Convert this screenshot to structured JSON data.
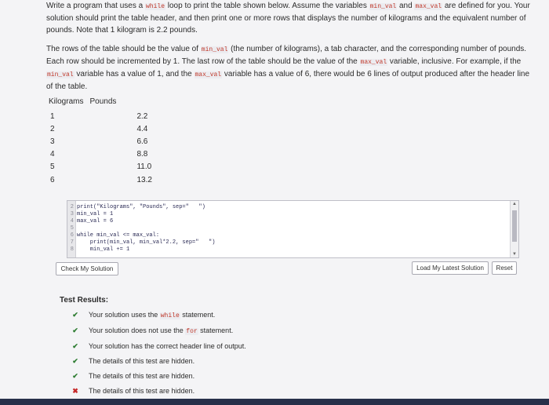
{
  "instructions": {
    "p1_a": "Write a program that uses a ",
    "p1_kw1": "while",
    "p1_b": " loop to print the table shown below. Assume the variables ",
    "p1_kw2": "min_val",
    "p1_c": " and ",
    "p1_kw3": "max_val",
    "p1_d": " are defined for you. Your solution should print the table header, and then print one or more rows that displays the number of kilograms and the equivalent number of pounds. Note that 1 kilogram is 2.2 pounds.",
    "p2_a": "The rows of the table should be the value of ",
    "p2_kw1": "min_val",
    "p2_b": " (the number of kilograms), a tab character, and the corresponding number of pounds. Each row should be incremented by 1. The last row of the table should be the value of the ",
    "p2_kw2": "max_val",
    "p2_c": " variable, inclusive. For example, if the ",
    "p2_kw3": "min_val",
    "p2_d": " variable has a value of 1, and the ",
    "p2_kw4": "max_val",
    "p2_e": " variable has a value of 6, there would be 6 lines of output produced after the header line of the table."
  },
  "sample_table": {
    "headers": [
      "Kilograms",
      "Pounds"
    ],
    "rows": [
      [
        "1",
        "2.2"
      ],
      [
        "2",
        "4.4"
      ],
      [
        "3",
        "6.6"
      ],
      [
        "4",
        "8.8"
      ],
      [
        "5",
        "11.0"
      ],
      [
        "6",
        "13.2"
      ]
    ]
  },
  "code_editor": {
    "lines": [
      {
        "num": "2",
        "code": "print(\"Kilograms\", \"Pounds\", sep=\"   \")"
      },
      {
        "num": "3",
        "code": "min_val = 1"
      },
      {
        "num": "4",
        "code": "max_val = 6"
      },
      {
        "num": "5",
        "code": ""
      },
      {
        "num": "6",
        "code": "while min_val <= max_val:"
      },
      {
        "num": "7",
        "code": "    print(min_val, min_val*2.2, sep=\"   \")"
      },
      {
        "num": "8",
        "code": "    min_val += 1"
      }
    ]
  },
  "buttons": {
    "check": "Check My Solution",
    "load": "Load My Latest Solution",
    "reset": "Reset"
  },
  "test_results": {
    "title": "Test Results:",
    "items": [
      {
        "status": "pass",
        "text_a": "Your solution uses the ",
        "code": "while",
        "text_b": " statement."
      },
      {
        "status": "pass",
        "text_a": "Your solution does not use the ",
        "code": "for",
        "text_b": " statement."
      },
      {
        "status": "pass",
        "text_a": "Your solution has the correct header line of output.",
        "code": "",
        "text_b": ""
      },
      {
        "status": "pass",
        "text_a": "The details of this test are hidden.",
        "code": "",
        "text_b": ""
      },
      {
        "status": "pass",
        "text_a": "The details of this test are hidden.",
        "code": "",
        "text_b": ""
      },
      {
        "status": "fail",
        "text_a": "The details of this test are hidden.",
        "code": "",
        "text_b": ""
      }
    ],
    "pass_glyph": "✔",
    "fail_glyph": "✖"
  },
  "colors": {
    "keyword": "#c0392b",
    "pass": "#2e7d32",
    "fail": "#c62828"
  }
}
